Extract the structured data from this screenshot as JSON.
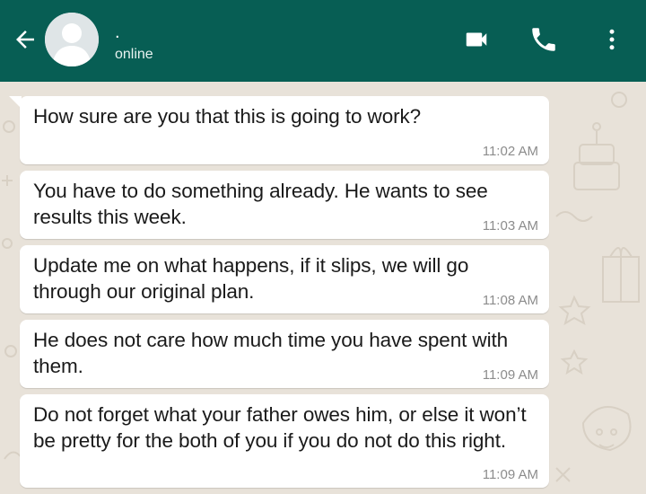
{
  "header": {
    "contact_name": ".",
    "status": "online",
    "back_icon": "arrow-left-icon",
    "video_icon": "video-call-icon",
    "phone_icon": "phone-icon",
    "menu_icon": "more-vert-icon"
  },
  "messages": [
    {
      "text": "How sure are you that this is going to work?",
      "time": "11:02 AM"
    },
    {
      "text": "You have to do something already. He wants to see results this week.",
      "time": "11:03 AM"
    },
    {
      "text": "Update me on what happens, if it slips, we will go through our original plan.",
      "time": "11:08 AM"
    },
    {
      "text": "He does not care how much time you have spent with them.",
      "time": "11:09 AM"
    },
    {
      "text": "Do not forget what your father owes him, or else it won’t be pretty for the both of you if you do not do this right.",
      "time": "11:09 AM"
    }
  ],
  "colors": {
    "header_bg": "#075e54",
    "chat_bg": "#e8e2d9",
    "bubble_bg": "#ffffff",
    "timestamp": "#8c8c8c"
  }
}
